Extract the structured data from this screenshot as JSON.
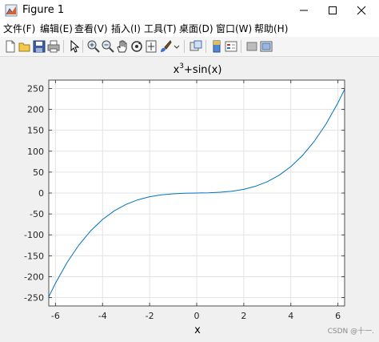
{
  "window": {
    "title": "Figure 1"
  },
  "menu": [
    "文件(F)",
    "编辑(E)",
    "查看(V)",
    "插入(I)",
    "工具(T)",
    "桌面(D)",
    "窗口(W)",
    "帮助(H)"
  ],
  "toolbar_icons": [
    "new-figure-icon",
    "open-file-icon",
    "save-icon",
    "print-icon",
    "edit-plot-arrow-icon",
    "zoom-in-icon",
    "zoom-out-icon",
    "pan-hand-icon",
    "rotate-3d-icon",
    "data-cursor-icon",
    "brush-icon",
    "link-plot-icon",
    "colorbar-icon",
    "legend-icon",
    "hide-plot-tools-icon",
    "show-plot-tools-icon"
  ],
  "watermark": "CSDN @十一.",
  "chart_data": {
    "type": "line",
    "title_base": "x",
    "title_sup": "3",
    "title_rest": "+sin(x)",
    "xlabel": "x",
    "ylabel": "",
    "xlim": [
      -6.2832,
      6.2832
    ],
    "ylim": [
      -270,
      270
    ],
    "xticks": [
      -6,
      -4,
      -2,
      0,
      2,
      4,
      6
    ],
    "yticks": [
      -250,
      -200,
      -150,
      -100,
      -50,
      0,
      50,
      100,
      150,
      200,
      250
    ],
    "grid": true,
    "series": [
      {
        "color": "#0072bd",
        "x": [
          -6.2832,
          -6.0,
          -5.5,
          -5.0,
          -4.5,
          -4.0,
          -3.5,
          -3.0,
          -2.5,
          -2.0,
          -1.5,
          -1.0,
          -0.5,
          0.0,
          0.5,
          1.0,
          1.5,
          2.0,
          2.5,
          3.0,
          3.5,
          4.0,
          4.5,
          5.0,
          5.5,
          6.0,
          6.2832
        ],
        "y": [
          -248.05,
          -215.72,
          -165.67,
          -124.04,
          -90.15,
          -63.24,
          -42.52,
          -27.14,
          -16.22,
          -8.91,
          -4.37,
          -1.84,
          -0.6,
          0.0,
          0.6,
          1.84,
          4.37,
          8.91,
          16.22,
          27.14,
          42.52,
          63.24,
          90.15,
          124.04,
          165.67,
          215.72,
          248.05
        ]
      }
    ]
  }
}
